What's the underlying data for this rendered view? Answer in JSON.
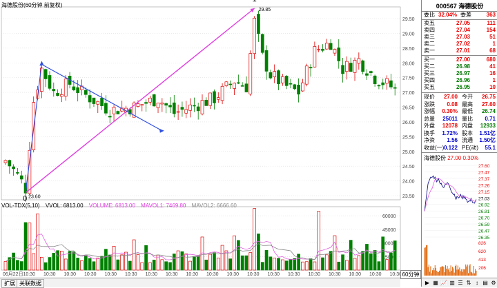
{
  "chart": {
    "title": "海德股份(60分钟 前复权)",
    "y_ticks": [
      "29.50",
      "29.00",
      "28.50",
      "28.00",
      "27.50",
      "27.00",
      "26.50",
      "26.00",
      "25.50",
      "25.00",
      "24.50",
      "24.00",
      "23.50"
    ],
    "marker_labels": [
      "0",
      "1"
    ],
    "price_labels": {
      "high": "29.85",
      "low": "23.60"
    }
  },
  "volume": {
    "indicator": "VOL-TDX(5,10)",
    "vvol": "VVOL: 6813.00",
    "volume": "VOLUME: 6813.00",
    "mavol1": "MAVOL1: 7469.80",
    "mavol2": "MAVOL2: 6666.60",
    "y_ticks": [
      "60000",
      "45000",
      "30000",
      "15000"
    ],
    "x_ticks": [
      "06月22日",
      "10:30",
      "10:30",
      "10:30",
      "10:30",
      "10:30",
      "10:30",
      "10:30",
      "10:30",
      "10:30",
      "10:30",
      "10:30",
      "10:30",
      "10:30",
      "10:30",
      "10:30",
      "10:30",
      "10:30",
      "10:30",
      "10:30"
    ]
  },
  "bottom_tabs": [
    "扩展",
    "关联数据"
  ],
  "period_tab": "60分钟",
  "quote": {
    "code_name": "000567 海德股份",
    "weibi": {
      "label": "委比",
      "value": "32.04%",
      "label2": "委差",
      "value2": "363"
    },
    "asks": [
      {
        "label": "卖五",
        "price": "27.05",
        "vol": "111"
      },
      {
        "label": "卖四",
        "price": "27.04",
        "vol": "154"
      },
      {
        "label": "卖三",
        "price": "27.03",
        "vol": "51"
      },
      {
        "label": "卖二",
        "price": "27.02",
        "vol": "1"
      },
      {
        "label": "卖一",
        "price": "27.01",
        "vol": "68"
      }
    ],
    "bids": [
      {
        "label": "买一",
        "price": "27.00",
        "vol": "680"
      },
      {
        "label": "买二",
        "price": "26.98",
        "vol": "41"
      },
      {
        "label": "买三",
        "price": "26.97",
        "vol": "16"
      },
      {
        "label": "买四",
        "price": "26.96",
        "vol": "1"
      },
      {
        "label": "买五",
        "price": "26.95",
        "vol": "10"
      }
    ],
    "stats": [
      {
        "l1": "现价",
        "v1": "27.00",
        "l2": "今开",
        "v2": "26.75"
      },
      {
        "l1": "涨跌",
        "v1": "0.08",
        "l2": "最高",
        "v2": "27.60"
      },
      {
        "l1": "涨幅",
        "v1": "0.30%",
        "l2": "最低",
        "v2": "26.74"
      },
      {
        "l1": "总量",
        "v1": "25011",
        "l2": "量比",
        "v2": "0.71"
      },
      {
        "l1": "外盘",
        "v1": "12078",
        "l2": "内盘",
        "v2": "12933"
      },
      {
        "l1": "换手",
        "v1": "1.72%",
        "l2": "股本",
        "v2": "1.51亿"
      },
      {
        "l1": "净资",
        "v1": "1.56",
        "l2": "流通",
        "v2": "1.50亿"
      },
      {
        "l1": "收益(一)",
        "v1": "0.122",
        "l2": "PE(动)",
        "v2": "55.1"
      }
    ],
    "mini_title": "海德股份",
    "mini_price": "27.00 0.30%",
    "mini_ticks": [
      "27.60",
      "27.47",
      "27.37",
      "27.26",
      "27.15",
      "27.03",
      "26.92",
      "26.81",
      "26.70",
      "26.59",
      "26.47",
      "26.35"
    ],
    "mini_vol_ticks": [
      "826",
      "620",
      "413",
      "206"
    ]
  },
  "colors": {
    "up": "#e00000",
    "down": "#008000",
    "trend_pink": "#e040e0",
    "trend_blue": "#3050e0",
    "ma_pink": "#e060e0"
  }
}
